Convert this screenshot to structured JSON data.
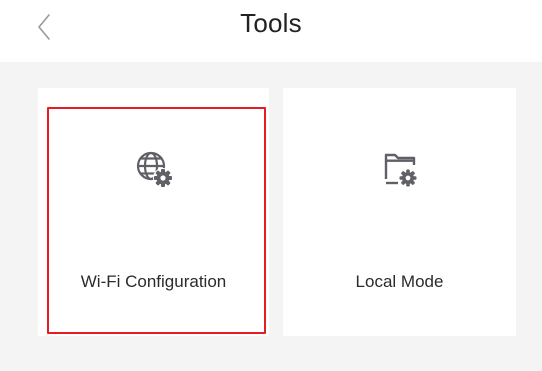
{
  "header": {
    "back_icon": "chevron-left-icon",
    "title": "Tools"
  },
  "tools": [
    {
      "label": "Wi-Fi Configuration",
      "icon": "globe-gear-icon",
      "highlighted": true
    },
    {
      "label": "Local Mode",
      "icon": "folder-gear-icon",
      "highlighted": false
    }
  ],
  "colors": {
    "background": "#f4f4f5",
    "card": "#ffffff",
    "icon": "#5f6166",
    "highlight_border": "#e51c23",
    "text": "#2b2b2b"
  }
}
